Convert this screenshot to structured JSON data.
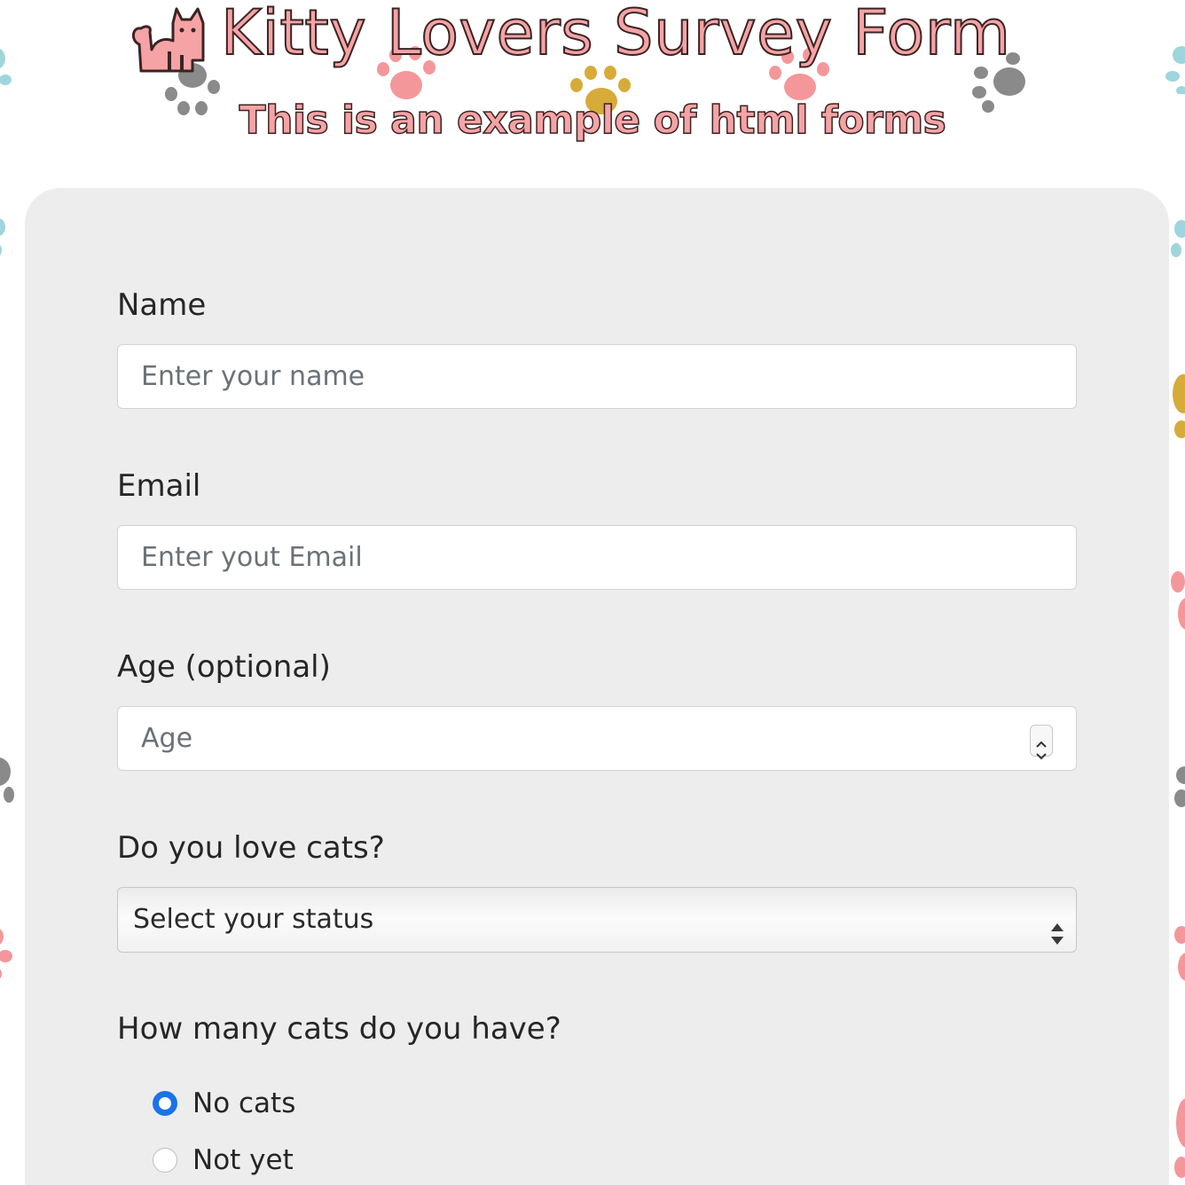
{
  "header": {
    "title": "Kitty Lovers Survey Form",
    "subtitle": "This is an example of html forms"
  },
  "form": {
    "name": {
      "label": "Name",
      "placeholder": "Enter your name",
      "value": ""
    },
    "email": {
      "label": "Email",
      "placeholder": "Enter yout Email",
      "value": ""
    },
    "age": {
      "label": "Age (optional)",
      "placeholder": "Age",
      "value": ""
    },
    "love_cats": {
      "label": "Do you love cats?",
      "selected": "Select your status"
    },
    "cat_count": {
      "label": "How many cats do you have?",
      "options": [
        {
          "label": "No cats",
          "checked": true
        },
        {
          "label": "Not yet",
          "checked": false
        }
      ]
    }
  },
  "colors": {
    "accent_pink": "#f6a3a5",
    "paw_gray": "#8a8a8a",
    "paw_gold": "#d7ab3a",
    "paw_teal": "#9fd5dc",
    "radio_checked": "#1a73e8",
    "card_bg": "#ededed"
  },
  "icons": {
    "cat_logo": "sitting-cat-icon",
    "paw": "paw-print-icon",
    "spinner": "number-spinner-icon",
    "select": "select-updown-icon"
  }
}
